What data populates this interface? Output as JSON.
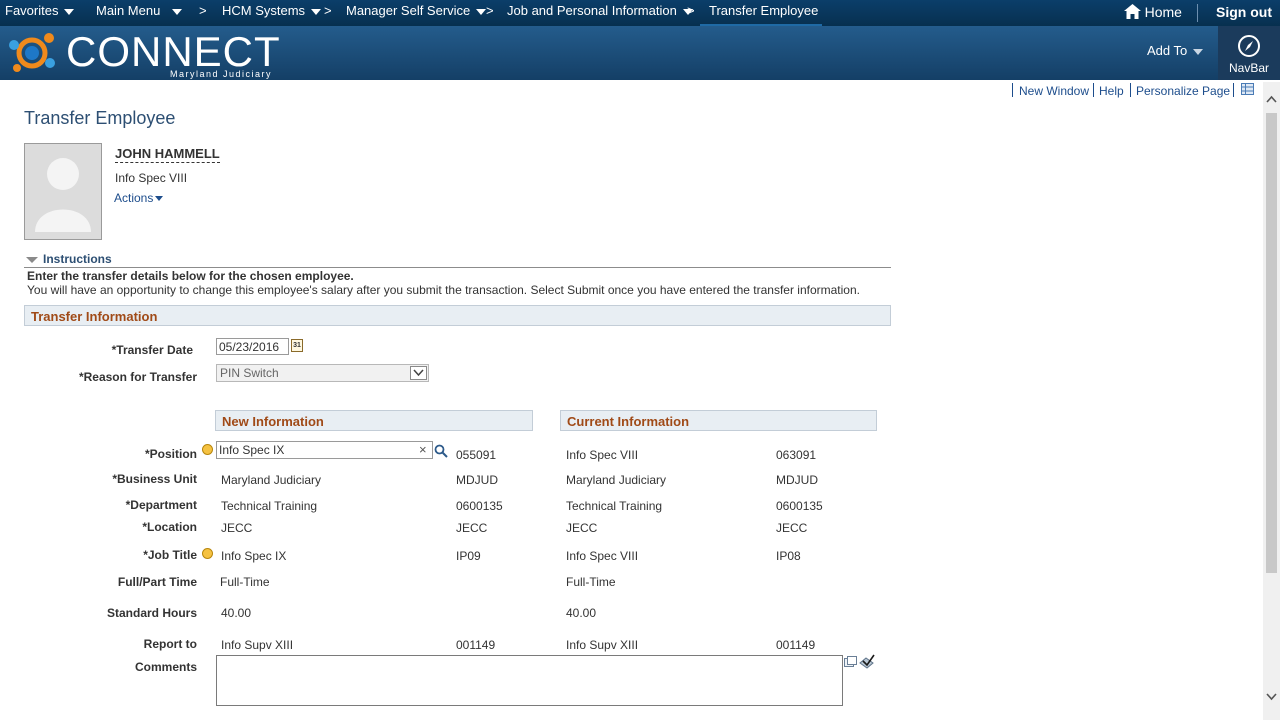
{
  "topnav": {
    "favorites": "Favorites",
    "main_menu": "Main Menu",
    "hcm_systems": "HCM Systems",
    "manager_self_service": "Manager Self Service",
    "job_personal": "Job and Personal Information",
    "current": "Transfer Employee",
    "separator": ">",
    "home": "Home",
    "sign_out": "Sign out"
  },
  "banner": {
    "logo_word": "CONNECT",
    "logo_sub": "Maryland Judiciary",
    "add_to": "Add To",
    "navbar": "NavBar"
  },
  "pagebar": {
    "new_window": "New Window",
    "help": "Help",
    "personalize": "Personalize Page"
  },
  "page": {
    "title": "Transfer Employee"
  },
  "employee": {
    "name": "JOHN HAMMELL",
    "job": "Info Spec VIII",
    "actions": "Actions"
  },
  "instructions": {
    "toggle": "Instructions",
    "line1": "Enter the transfer details below for the chosen employee.",
    "line2": "You will have an opportunity to change this employee's salary after you submit the transaction. Select Submit once you have entered the transfer information."
  },
  "transfer": {
    "header": "Transfer Information",
    "date_label": "*Transfer Date",
    "date_value": "05/23/2016",
    "calendar_glyph": "31",
    "reason_label": "*Reason for Transfer",
    "reason_value": "PIN Switch"
  },
  "columns": {
    "new_header": "New Information",
    "current_header": "Current Information"
  },
  "rows": {
    "position": {
      "label": "*Position",
      "new": "Info Spec IX",
      "new_code": "055091",
      "cur": "Info Spec VIII",
      "cur_code": "063091",
      "clear": "×"
    },
    "business_unit": {
      "label": "*Business Unit",
      "new": "Maryland Judiciary",
      "new_code": "MDJUD",
      "cur": "Maryland Judiciary",
      "cur_code": "MDJUD"
    },
    "department": {
      "label": "*Department",
      "new": "Technical Training",
      "new_code": "0600135",
      "cur": "Technical Training",
      "cur_code": "0600135"
    },
    "location": {
      "label": "*Location",
      "new": "JECC",
      "new_code": "JECC",
      "cur": "JECC",
      "cur_code": "JECC"
    },
    "job_title": {
      "label": "*Job Title",
      "new": "Info Spec IX",
      "new_code": "IP09",
      "cur": "Info Spec VIII",
      "cur_code": "IP08"
    },
    "full_part": {
      "label": "Full/Part Time",
      "new": "Full-Time",
      "cur": "Full-Time"
    },
    "std_hours": {
      "label": "Standard Hours",
      "new": "40.00",
      "cur": "40.00"
    },
    "report_to": {
      "label": "Report to",
      "new": "Info Supv XIII",
      "new_code": "001149",
      "cur": "Info Supv XIII",
      "cur_code": "001149"
    },
    "comments": {
      "label": "Comments",
      "value": ""
    }
  },
  "colors": {
    "topbar": "#0b3e6a",
    "banner": "#245c8c",
    "section_header_text": "#a04a17",
    "link": "#1d4d8c",
    "required_dot": "#f5c242"
  }
}
